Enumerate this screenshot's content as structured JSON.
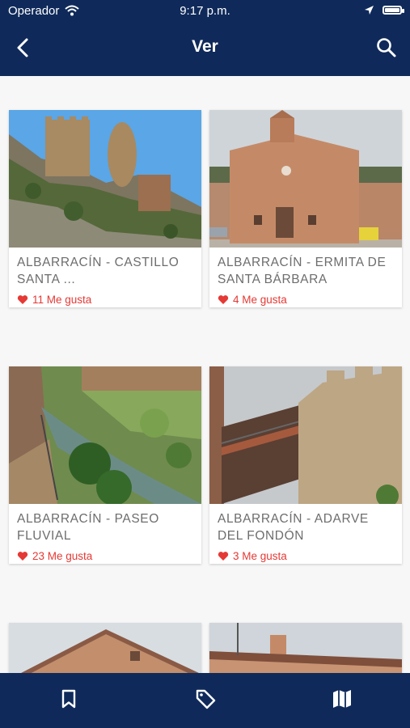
{
  "status": {
    "carrier": "Operador",
    "time": "9:17 p.m."
  },
  "header": {
    "title": "Ver"
  },
  "colors": {
    "bar": "#0f2a5a",
    "accent": "#e53935"
  },
  "icons": {
    "back": "chevron-left-icon",
    "search": "search-icon",
    "bookmark": "bookmark-icon",
    "tag": "tag-icon",
    "map": "map-icon",
    "like": "heart-icon"
  },
  "items": [
    {
      "title": "ALBARRACÍN  - CASTILLO SANTA ...",
      "likes": "11 Me gusta"
    },
    {
      "title": "ALBARRACÍN  - ERMITA DE SANTA BÁRBARA",
      "likes": "4 Me gusta"
    },
    {
      "title": "ALBARRACÍN  - PASEO FLUVIAL",
      "likes": "23 Me gusta"
    },
    {
      "title": "ALBARRACÍN - ADARVE DEL FONDÓN",
      "likes": "3 Me gusta"
    }
  ]
}
